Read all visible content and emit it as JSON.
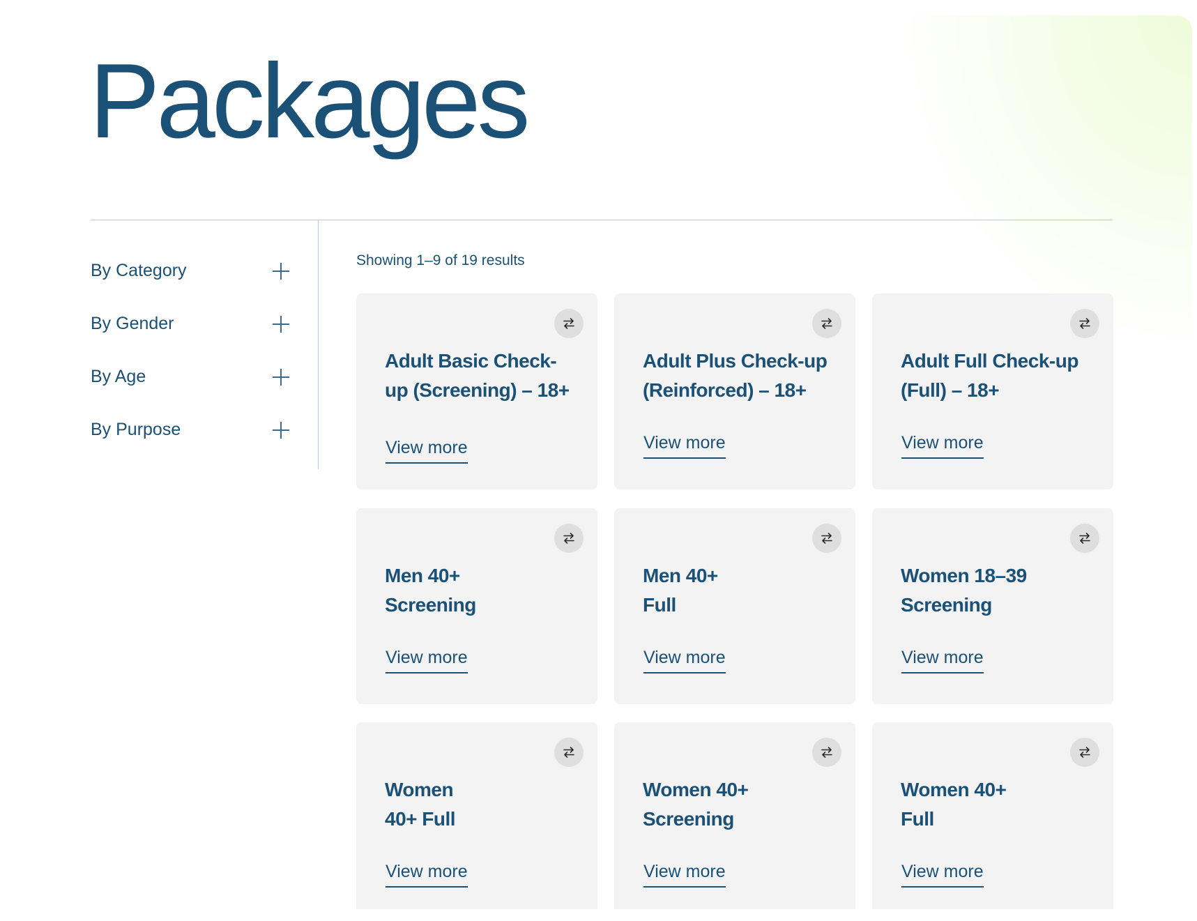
{
  "page": {
    "title": "Packages",
    "results_text": "Showing 1–9 of 19 results"
  },
  "filters": [
    {
      "label": "By Category"
    },
    {
      "label": "By Gender"
    },
    {
      "label": "By Age"
    },
    {
      "label": "By Purpose"
    }
  ],
  "cards": [
    {
      "title": "Adult Basic Check-\nup (Screening) – 18+",
      "link": "View more"
    },
    {
      "title": "Adult Plus Check-up\n(Reinforced) – 18+",
      "link": "View more"
    },
    {
      "title": "Adult Full Check-up\n(Full) – 18+",
      "link": "View more"
    },
    {
      "title": "Men 40+\nScreening",
      "link": "View more"
    },
    {
      "title": "Men 40+\nFull",
      "link": "View more"
    },
    {
      "title": "Women 18–39\nScreening",
      "link": "View more"
    },
    {
      "title": "Women\n40+ Full",
      "link": "View more"
    },
    {
      "title": "Women 40+\nScreening",
      "link": "View more"
    },
    {
      "title": "Women 40+\nFull",
      "link": "View more"
    }
  ],
  "icons": {
    "filter_toggle": "plus-icon",
    "card_action": "compare-arrows-icon"
  },
  "colors": {
    "primary": "#1b5177",
    "card_bg": "#f3f3f3",
    "divider": "#b9cbd8",
    "accent_glow": "#eefcd9"
  }
}
